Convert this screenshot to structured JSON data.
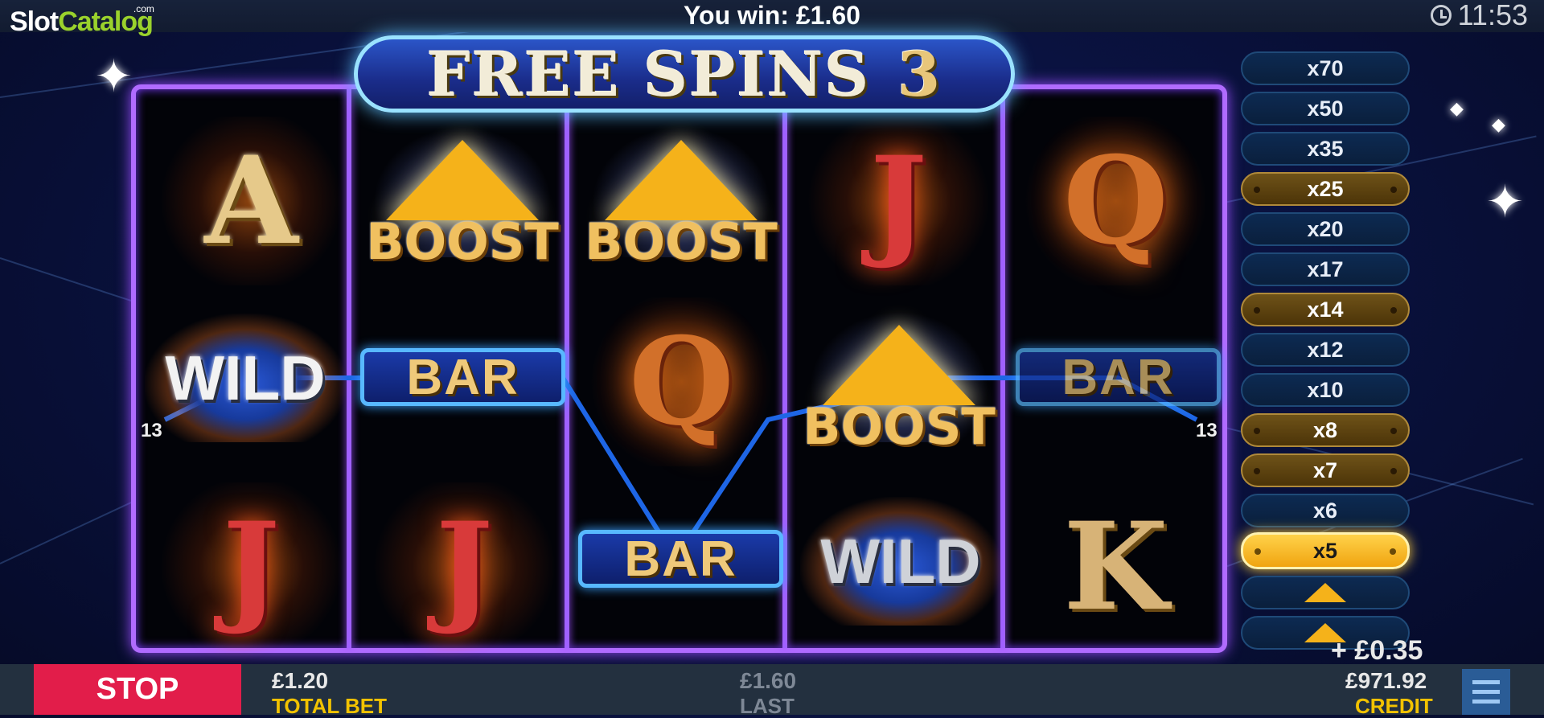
{
  "branding": {
    "logo_slot": "Slot",
    "logo_catalog": "Catalog",
    "logo_com": ".com"
  },
  "status": {
    "win_text": "You win: £1.60",
    "time": "11:53"
  },
  "banner": {
    "text": "FREE SPINS",
    "count": "3"
  },
  "reels": {
    "r1": [
      "A",
      "WILD",
      "J"
    ],
    "r2": [
      "BOOST",
      "BAR",
      "J"
    ],
    "r3": [
      "BOOST",
      "Q",
      "BAR"
    ],
    "r4": [
      "J",
      "BOOST",
      "WILD"
    ],
    "r5": [
      "Q",
      "BAR",
      "K"
    ],
    "winning_line": {
      "number_left": "13",
      "number_right": "13"
    }
  },
  "multipliers": [
    {
      "label": "x70",
      "state": "off"
    },
    {
      "label": "x50",
      "state": "off"
    },
    {
      "label": "x35",
      "state": "off"
    },
    {
      "label": "x25",
      "state": "lit"
    },
    {
      "label": "x20",
      "state": "off"
    },
    {
      "label": "x17",
      "state": "off"
    },
    {
      "label": "x14",
      "state": "lit"
    },
    {
      "label": "x12",
      "state": "off"
    },
    {
      "label": "x10",
      "state": "off"
    },
    {
      "label": "x8",
      "state": "lit"
    },
    {
      "label": "x7",
      "state": "lit"
    },
    {
      "label": "x6",
      "state": "off"
    },
    {
      "label": "x5",
      "state": "active"
    }
  ],
  "bonus_increment": "+ £0.35",
  "footer": {
    "stop_label": "STOP",
    "total_bet_value": "£1.20",
    "total_bet_label": "TOTAL BET",
    "last_value": "£1.60",
    "last_label": "LAST",
    "credit_value": "£971.92",
    "credit_label": "CREDIT"
  },
  "colors": {
    "stop": "#e21d4a",
    "frame": "#b06bff",
    "accent_gold": "#f2c200",
    "multiplier_active": "#ffc62a"
  }
}
